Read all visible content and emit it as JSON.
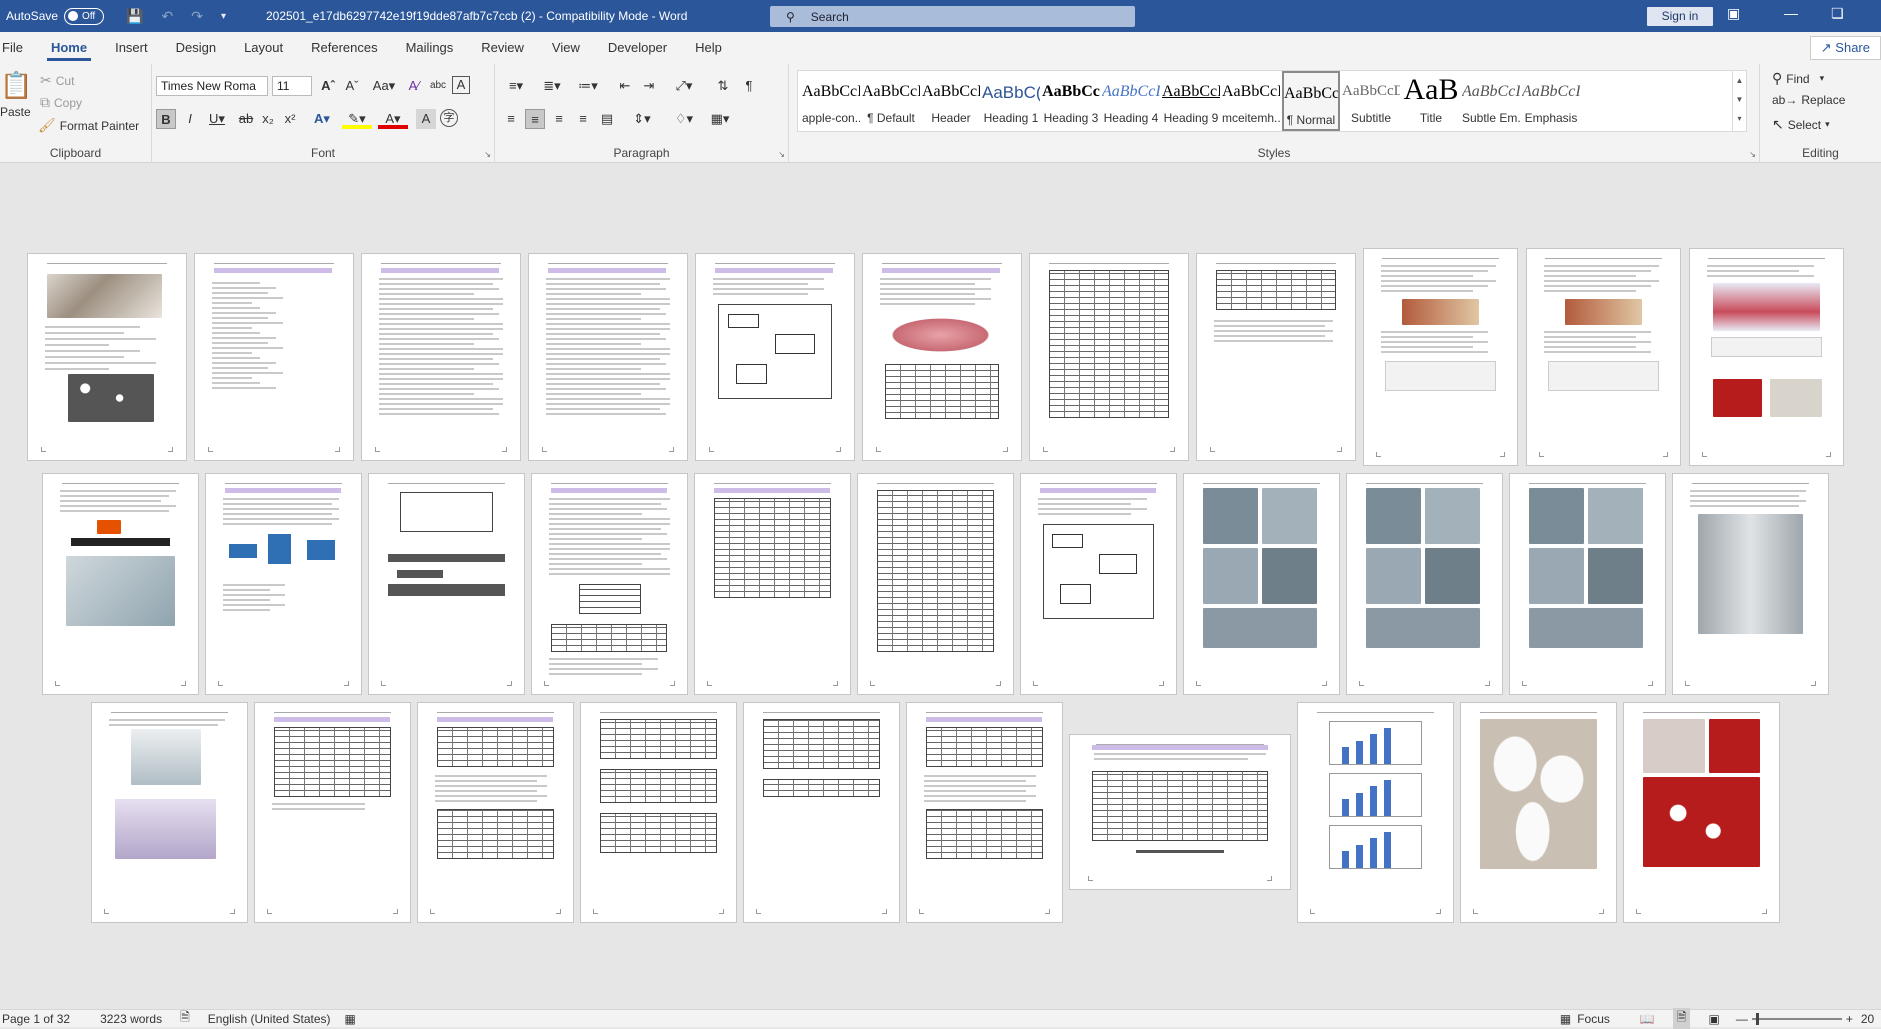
{
  "titlebar": {
    "autosave_label": "AutoSave",
    "autosave_state": "Off",
    "document_title": "202501_e17db6297742e19f19dde87afb7c7ccb (2)  -  Compatibility Mode  -  Word",
    "search_placeholder": "Search",
    "signin_label": "Sign in"
  },
  "tabs": [
    "File",
    "Home",
    "Insert",
    "Design",
    "Layout",
    "References",
    "Mailings",
    "Review",
    "View",
    "Developer",
    "Help"
  ],
  "active_tab": "Home",
  "share_label": "Share",
  "ribbon": {
    "clipboard": {
      "label": "Clipboard",
      "paste": "Paste",
      "cut": "Cut",
      "copy": "Copy",
      "format_painter": "Format Painter"
    },
    "font": {
      "label": "Font",
      "font_name": "Times New Roma",
      "font_size": "11"
    },
    "paragraph": {
      "label": "Paragraph"
    },
    "styles": {
      "label": "Styles",
      "items": [
        {
          "sample": "AaBbCcI",
          "name": "apple-con..."
        },
        {
          "sample": "AaBbCcI",
          "name": "¶ Default"
        },
        {
          "sample": "AaBbCcDc",
          "name": "Header"
        },
        {
          "sample": "AaBbC(",
          "name": "Heading 1"
        },
        {
          "sample": "AaBbCc",
          "name": "Heading 3"
        },
        {
          "sample": "AaBbCcI",
          "name": "Heading 4"
        },
        {
          "sample": "AaBbCcI",
          "name": "Heading 9"
        },
        {
          "sample": "AaBbCcI",
          "name": "mceitemh..."
        },
        {
          "sample": "AaBbCcI",
          "name": "¶ Normal"
        },
        {
          "sample": "AaBbCcD",
          "name": "Subtitle"
        },
        {
          "sample": "AaB",
          "name": "Title"
        },
        {
          "sample": "AaBbCcI",
          "name": "Subtle Em..."
        },
        {
          "sample": "AaBbCcI",
          "name": "Emphasis"
        }
      ],
      "selected": "¶ Normal"
    },
    "editing": {
      "label": "Editing",
      "find": "Find",
      "replace": "Replace",
      "select": "Select"
    }
  },
  "status": {
    "page": "Page 1 of 32",
    "words": "3223 words",
    "language": "English (United States)",
    "focus": "Focus",
    "zoom": "20"
  }
}
